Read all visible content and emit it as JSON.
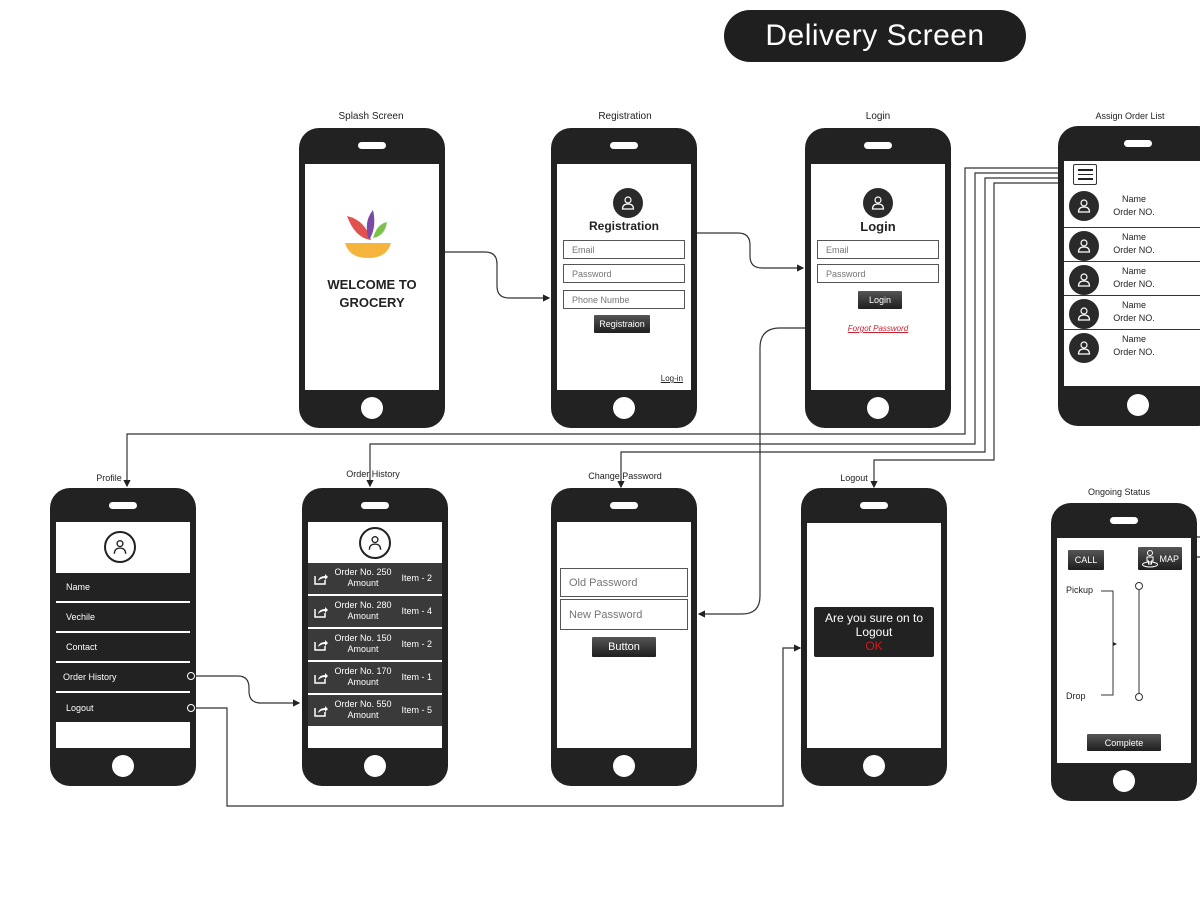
{
  "title": "Delivery Screen",
  "screens": {
    "splash": {
      "label": "Splash Screen",
      "welcome_line1": "WELCOME TO",
      "welcome_line2": "GROCERY",
      "logo_colors": {
        "red": "#e0524f",
        "purple": "#7b4aa6",
        "green": "#7cc24a",
        "bowl": "#f5b53d"
      }
    },
    "registration": {
      "label": "Registration",
      "heading": "Registration",
      "email_placeholder": "Email",
      "password_placeholder": "Password",
      "phone_placeholder": "Phone Numbe",
      "submit_label": "Registraion",
      "login_link": "Log-in"
    },
    "login": {
      "label": "Login",
      "heading": "Login",
      "email_placeholder": "Email",
      "password_placeholder": "Password",
      "submit_label": "Login",
      "forgot_link": "Forgot Password",
      "forgot_color": "#cc1f2f"
    },
    "assign_order_list": {
      "label": "Assign Order List",
      "menu_icon": "hamburger-menu-icon",
      "items": [
        {
          "name": "Name",
          "order": "Order NO."
        },
        {
          "name": "Name",
          "order": "Order NO."
        },
        {
          "name": "Name",
          "order": "Order NO."
        },
        {
          "name": "Name",
          "order": "Order NO."
        },
        {
          "name": "Name",
          "order": "Order NO."
        }
      ]
    },
    "profile": {
      "label": "Profile",
      "items": [
        "Name",
        "Vechile",
        "Contact",
        "Order History",
        "Logout"
      ]
    },
    "order_history": {
      "label": "Order History",
      "orders": [
        {
          "order": "Order No. 250",
          "amount": "Amount",
          "items": "Item - 2"
        },
        {
          "order": "Order No. 280",
          "amount": "Amount",
          "items": "Item - 4"
        },
        {
          "order": "Order No. 150",
          "amount": "Amount",
          "items": "Item - 2"
        },
        {
          "order": "Order No. 170",
          "amount": "Amount",
          "items": "Item - 1"
        },
        {
          "order": "Order No. 550",
          "amount": "Amount",
          "items": "Item - 5"
        }
      ]
    },
    "change_password": {
      "label": "Change Password",
      "old_placeholder": "Old Password",
      "new_placeholder": "New Password",
      "button_label": "Button"
    },
    "logout": {
      "label": "Logout",
      "dialog_line1": "Are you sure on to",
      "dialog_line2": "Logout",
      "ok_label": "OK",
      "ok_color": "#d11a1a"
    },
    "ongoing_status": {
      "label": "Ongoing Status",
      "call_label": "CALL",
      "map_label": "MAP",
      "pickup_label": "Pickup",
      "drop_label": "Drop",
      "complete_label": "Complete"
    }
  }
}
